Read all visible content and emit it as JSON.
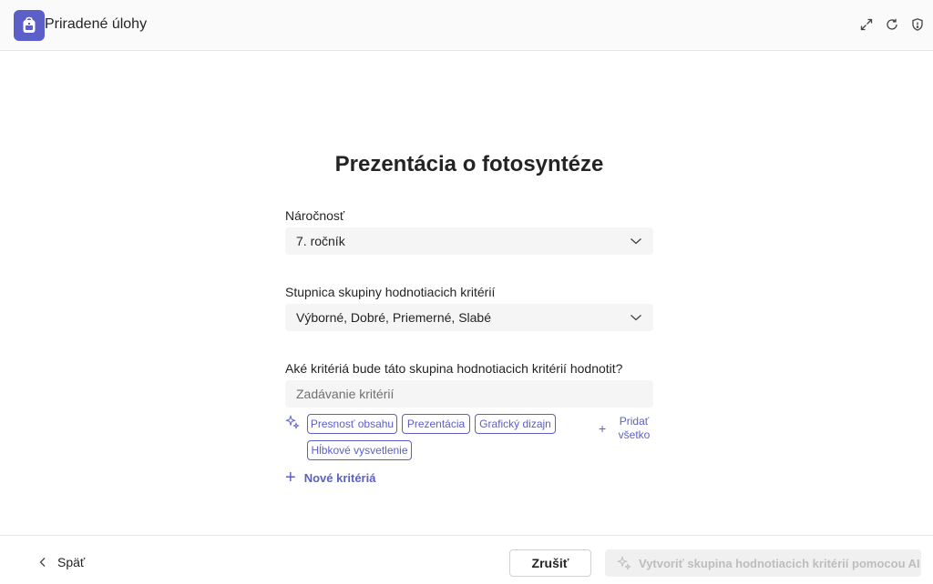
{
  "app": {
    "title": "Priradené úlohy",
    "icons": [
      "backpack-icon",
      "expand-icon",
      "refresh-icon",
      "shield-icon"
    ]
  },
  "main": {
    "title": "Prezentácia o fotosyntéze",
    "difficulty": {
      "label": "Náročnosť",
      "value": "7. ročník"
    },
    "scale": {
      "label": "Stupnica skupiny hodnotiacich kritérií",
      "value": "Výborné, Dobré, Priemerné, Slabé"
    },
    "criteria": {
      "label": "Aké kritériá bude táto skupina hodnotiacich kritérií hodnotit?",
      "placeholder": "Zadávanie kritérií",
      "suggestions": [
        "Presnosť obsahu",
        "Prezentácia",
        "Grafický dizajn",
        "Hĺbkové vysvetlenie"
      ],
      "add_all_line1": "Pridať",
      "add_all_line2": "všetko",
      "new_label": "Nové kritériá"
    }
  },
  "footer": {
    "back_label": "Späť",
    "cancel_label": "Zrušiť",
    "ai_label": "Vytvoriť skupina hodnotiacich kritérií pomocou AI"
  },
  "colors": {
    "accent": "#5b5fc7",
    "disabled_text": "#bdbdbd",
    "field_bg": "#f5f5f5"
  }
}
